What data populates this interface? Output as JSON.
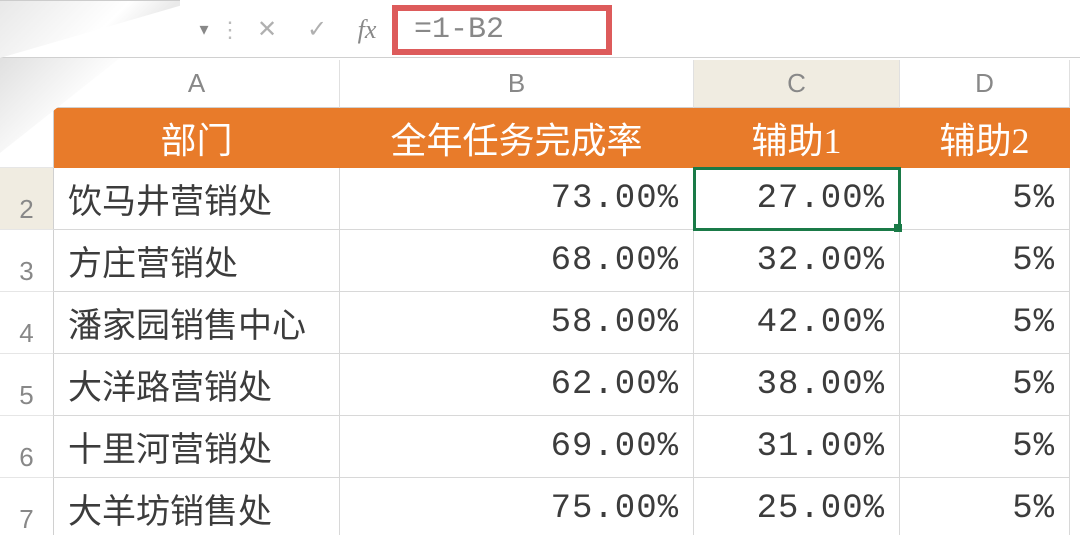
{
  "formula_bar": {
    "formula": "=1-B2",
    "fx_label": "fx",
    "cancel_glyph": "✕",
    "accept_glyph": "✓",
    "dropdown_glyph": "▾",
    "vdots_glyph": "⋮"
  },
  "columns": [
    "A",
    "B",
    "C",
    "D"
  ],
  "header": {
    "A": "部门",
    "B": "全年任务完成率",
    "C": "辅助1",
    "D": "辅助2"
  },
  "rows": [
    {
      "n": 2,
      "A": "饮马井营销处",
      "B": "73.00%",
      "C": "27.00%",
      "D": "5%"
    },
    {
      "n": 3,
      "A": "方庄营销处",
      "B": "68.00%",
      "C": "32.00%",
      "D": "5%"
    },
    {
      "n": 4,
      "A": "潘家园销售中心",
      "B": "58.00%",
      "C": "42.00%",
      "D": "5%"
    },
    {
      "n": 5,
      "A": "大洋路营销处",
      "B": "62.00%",
      "C": "38.00%",
      "D": "5%"
    },
    {
      "n": 6,
      "A": "十里河营销处",
      "B": "69.00%",
      "C": "31.00%",
      "D": "5%"
    },
    {
      "n": 7,
      "A": "大羊坊销售处",
      "B": "75.00%",
      "C": "25.00%",
      "D": "5%"
    }
  ],
  "active_cell": "C2",
  "colors": {
    "accent": "#e87b2a",
    "highlight_border": "#dd5b5b",
    "selection": "#1a7a47"
  }
}
